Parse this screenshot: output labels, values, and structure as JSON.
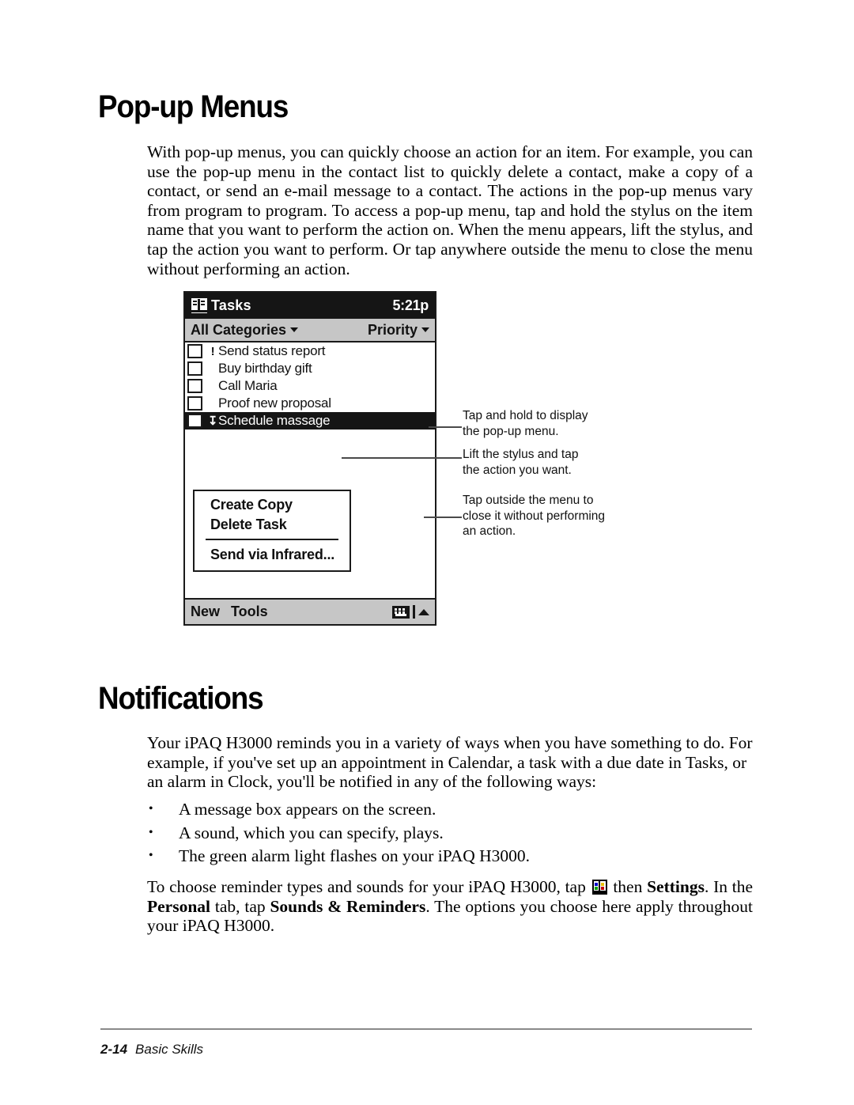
{
  "sections": {
    "popup_menus": {
      "heading": "Pop-up Menus",
      "paragraph": "With pop-up menus, you can quickly choose an action for an item. For example, you can use the pop-up menu in the contact list to quickly delete a contact, make a copy of a contact, or send an e-mail message to a contact. The actions in the pop-up menus vary from program to program. To access a pop-up menu, tap and hold the stylus on the item name that you want to perform the action on. When the menu appears, lift the stylus, and tap the action you want to perform. Or tap anywhere outside the menu to close the menu without performing an action."
    },
    "notifications": {
      "heading": "Notifications",
      "paragraph": "Your iPAQ H3000 reminds you in a variety of ways when you have something to do. For example, if you've set up an appointment in Calendar, a task with a due date in Tasks, or an alarm in Clock, you'll be notified in any of the following ways:",
      "bullets": [
        "A message box appears on the screen.",
        "A sound, which you can specify, plays.",
        "The green alarm light flashes on your iPAQ H3000."
      ],
      "settings_paragraph": {
        "part1": "To choose reminder types and sounds for your iPAQ H3000, tap ",
        "icon": "start-tasks-icon",
        "part2": " then ",
        "bold1": "Settings",
        "part3": ". In the ",
        "bold2": "Personal",
        "part4": " tab, tap ",
        "bold3": "Sounds & Reminders",
        "part5": ". The options you choose here apply throughout your iPAQ H3000."
      }
    }
  },
  "figure": {
    "device_screen": {
      "title_bar": {
        "icon": "tasks-book-icon",
        "app_title": "Tasks",
        "clock": "5:21p"
      },
      "filter_bar": {
        "category_label": "All Categories",
        "category_caret": "chevron-down-icon",
        "sort_label": "Priority",
        "sort_caret": "chevron-down-icon"
      },
      "tasks": [
        {
          "label": "Send status report",
          "priority": "!",
          "checked": false,
          "selected": false
        },
        {
          "label": "Buy birthday gift",
          "priority": "",
          "checked": false,
          "selected": false
        },
        {
          "label": "Call Maria",
          "priority": "",
          "checked": false,
          "selected": false
        },
        {
          "label": "Proof new proposal",
          "priority": "",
          "checked": false,
          "selected": false
        },
        {
          "label": "Schedule massage",
          "priority": "↧",
          "checked": false,
          "selected": true
        }
      ],
      "popup_menu": {
        "items": [
          "Create Copy",
          "Delete Task"
        ],
        "items_after_separator": [
          "Send via Infrared..."
        ]
      },
      "bottom_bar": {
        "new_label": "New",
        "tools_label": "Tools",
        "keyboard_icon": "keyboard-icon",
        "input-panel-arrow": "up-triangle-icon"
      }
    },
    "callouts": [
      "Tap and hold to display\nthe pop-up menu.",
      "Lift the stylus and tap\nthe action you want.",
      "Tap outside the menu to\nclose it without performing\nan action."
    ]
  },
  "footer": {
    "page_number": "2-14",
    "section_name": "Basic Skills"
  },
  "colors": {
    "text": "#000000",
    "title_bar_bg": "#151515",
    "toolbar_bg": "#c6c6c6",
    "rule": "#8a8a8a",
    "leader": "#4a4a4a"
  }
}
